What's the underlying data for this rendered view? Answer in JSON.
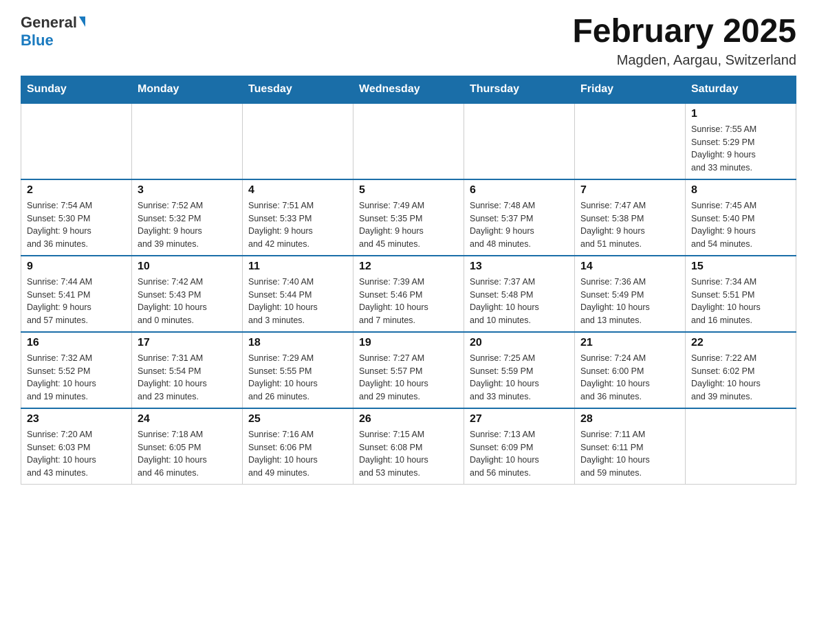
{
  "header": {
    "logo": {
      "general": "General",
      "blue": "Blue"
    },
    "title": "February 2025",
    "subtitle": "Magden, Aargau, Switzerland"
  },
  "weekdays": [
    "Sunday",
    "Monday",
    "Tuesday",
    "Wednesday",
    "Thursday",
    "Friday",
    "Saturday"
  ],
  "weeks": [
    [
      {
        "day": "",
        "info": ""
      },
      {
        "day": "",
        "info": ""
      },
      {
        "day": "",
        "info": ""
      },
      {
        "day": "",
        "info": ""
      },
      {
        "day": "",
        "info": ""
      },
      {
        "day": "",
        "info": ""
      },
      {
        "day": "1",
        "info": "Sunrise: 7:55 AM\nSunset: 5:29 PM\nDaylight: 9 hours\nand 33 minutes."
      }
    ],
    [
      {
        "day": "2",
        "info": "Sunrise: 7:54 AM\nSunset: 5:30 PM\nDaylight: 9 hours\nand 36 minutes."
      },
      {
        "day": "3",
        "info": "Sunrise: 7:52 AM\nSunset: 5:32 PM\nDaylight: 9 hours\nand 39 minutes."
      },
      {
        "day": "4",
        "info": "Sunrise: 7:51 AM\nSunset: 5:33 PM\nDaylight: 9 hours\nand 42 minutes."
      },
      {
        "day": "5",
        "info": "Sunrise: 7:49 AM\nSunset: 5:35 PM\nDaylight: 9 hours\nand 45 minutes."
      },
      {
        "day": "6",
        "info": "Sunrise: 7:48 AM\nSunset: 5:37 PM\nDaylight: 9 hours\nand 48 minutes."
      },
      {
        "day": "7",
        "info": "Sunrise: 7:47 AM\nSunset: 5:38 PM\nDaylight: 9 hours\nand 51 minutes."
      },
      {
        "day": "8",
        "info": "Sunrise: 7:45 AM\nSunset: 5:40 PM\nDaylight: 9 hours\nand 54 minutes."
      }
    ],
    [
      {
        "day": "9",
        "info": "Sunrise: 7:44 AM\nSunset: 5:41 PM\nDaylight: 9 hours\nand 57 minutes."
      },
      {
        "day": "10",
        "info": "Sunrise: 7:42 AM\nSunset: 5:43 PM\nDaylight: 10 hours\nand 0 minutes."
      },
      {
        "day": "11",
        "info": "Sunrise: 7:40 AM\nSunset: 5:44 PM\nDaylight: 10 hours\nand 3 minutes."
      },
      {
        "day": "12",
        "info": "Sunrise: 7:39 AM\nSunset: 5:46 PM\nDaylight: 10 hours\nand 7 minutes."
      },
      {
        "day": "13",
        "info": "Sunrise: 7:37 AM\nSunset: 5:48 PM\nDaylight: 10 hours\nand 10 minutes."
      },
      {
        "day": "14",
        "info": "Sunrise: 7:36 AM\nSunset: 5:49 PM\nDaylight: 10 hours\nand 13 minutes."
      },
      {
        "day": "15",
        "info": "Sunrise: 7:34 AM\nSunset: 5:51 PM\nDaylight: 10 hours\nand 16 minutes."
      }
    ],
    [
      {
        "day": "16",
        "info": "Sunrise: 7:32 AM\nSunset: 5:52 PM\nDaylight: 10 hours\nand 19 minutes."
      },
      {
        "day": "17",
        "info": "Sunrise: 7:31 AM\nSunset: 5:54 PM\nDaylight: 10 hours\nand 23 minutes."
      },
      {
        "day": "18",
        "info": "Sunrise: 7:29 AM\nSunset: 5:55 PM\nDaylight: 10 hours\nand 26 minutes."
      },
      {
        "day": "19",
        "info": "Sunrise: 7:27 AM\nSunset: 5:57 PM\nDaylight: 10 hours\nand 29 minutes."
      },
      {
        "day": "20",
        "info": "Sunrise: 7:25 AM\nSunset: 5:59 PM\nDaylight: 10 hours\nand 33 minutes."
      },
      {
        "day": "21",
        "info": "Sunrise: 7:24 AM\nSunset: 6:00 PM\nDaylight: 10 hours\nand 36 minutes."
      },
      {
        "day": "22",
        "info": "Sunrise: 7:22 AM\nSunset: 6:02 PM\nDaylight: 10 hours\nand 39 minutes."
      }
    ],
    [
      {
        "day": "23",
        "info": "Sunrise: 7:20 AM\nSunset: 6:03 PM\nDaylight: 10 hours\nand 43 minutes."
      },
      {
        "day": "24",
        "info": "Sunrise: 7:18 AM\nSunset: 6:05 PM\nDaylight: 10 hours\nand 46 minutes."
      },
      {
        "day": "25",
        "info": "Sunrise: 7:16 AM\nSunset: 6:06 PM\nDaylight: 10 hours\nand 49 minutes."
      },
      {
        "day": "26",
        "info": "Sunrise: 7:15 AM\nSunset: 6:08 PM\nDaylight: 10 hours\nand 53 minutes."
      },
      {
        "day": "27",
        "info": "Sunrise: 7:13 AM\nSunset: 6:09 PM\nDaylight: 10 hours\nand 56 minutes."
      },
      {
        "day": "28",
        "info": "Sunrise: 7:11 AM\nSunset: 6:11 PM\nDaylight: 10 hours\nand 59 minutes."
      },
      {
        "day": "",
        "info": ""
      }
    ]
  ]
}
